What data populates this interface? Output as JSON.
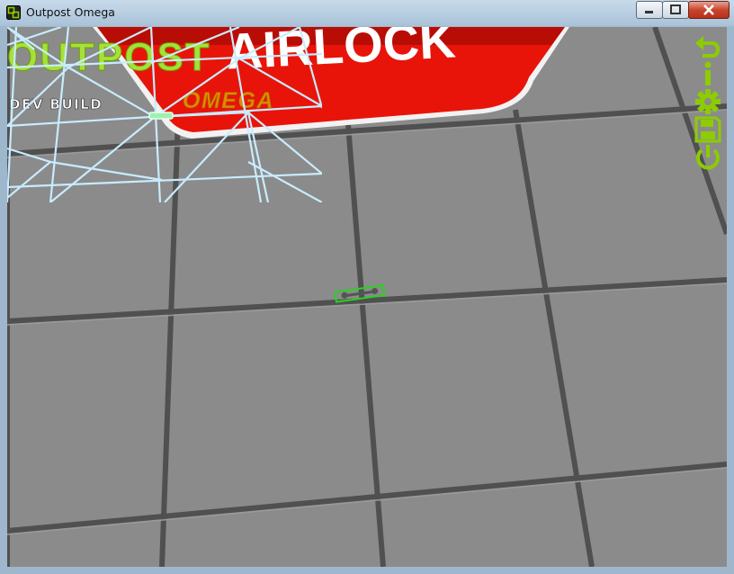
{
  "window": {
    "title": "Outpost Omega",
    "app_icon": "outpost-omega-app-icon",
    "controls": [
      "minimize-icon",
      "maximize-icon",
      "close-icon"
    ]
  },
  "game": {
    "logo_title": "OUTPOST",
    "logo_subtitle": "OMEGA",
    "build_label": "DEV BUILD",
    "sign_text": "AIRLOCK",
    "selected_item": "wrench",
    "colors": {
      "accent_green": "#8ccc00",
      "sign_red": "#e8140a",
      "subtitle_orange": "#e08a00",
      "floor": "#8a8a8a",
      "grid_line": "#4b4b4b",
      "selection": "#27d31e",
      "minimap_line": "#c8ecff"
    }
  },
  "hud": {
    "icons": [
      "undo-icon",
      "info-icon",
      "settings-gear-icon",
      "save-icon",
      "power-icon"
    ]
  }
}
